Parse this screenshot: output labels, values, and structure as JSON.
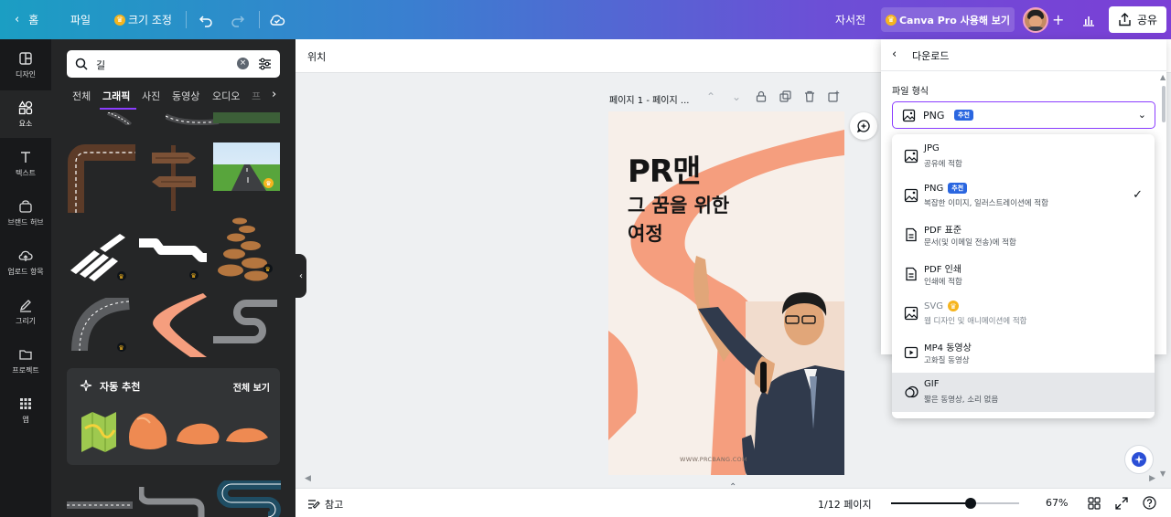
{
  "topbar": {
    "home": "홈",
    "file": "파일",
    "resize": "크기 조정",
    "doc_title": "자서전",
    "pro": "Canva Pro 사용해 보기",
    "share": "공유"
  },
  "rail": [
    {
      "label": "디자인",
      "icon": "layout-icon"
    },
    {
      "label": "요소",
      "icon": "elements-icon"
    },
    {
      "label": "텍스트",
      "icon": "text-icon"
    },
    {
      "label": "브랜드 허브",
      "icon": "brand-icon"
    },
    {
      "label": "업로드 항목",
      "icon": "upload-icon"
    },
    {
      "label": "그리기",
      "icon": "draw-icon"
    },
    {
      "label": "프로젝트",
      "icon": "folder-icon"
    },
    {
      "label": "앱",
      "icon": "apps-icon"
    }
  ],
  "panel": {
    "search_value": "길",
    "tabs": [
      "전체",
      "그래픽",
      "사진",
      "동영상",
      "오디오",
      "프"
    ],
    "ai_title": "자동 추천",
    "ai_all": "전체 보기"
  },
  "editor": {
    "position": "위치",
    "page_label": "페이지 1 - 페이지 ...",
    "notes": "참고",
    "page_count": "1/12 페이지",
    "zoom": "67%",
    "zoom_level": 0.62
  },
  "design": {
    "title": "PR맨",
    "subtitle_1": "그 꿈을 위한",
    "subtitle_2": "여정",
    "url": "WWW.PRCBANG.COM"
  },
  "download": {
    "title": "다운로드",
    "file_type_label": "파일 형식",
    "selected": "PNG",
    "recommended": "추천",
    "options": [
      {
        "name": "JPG",
        "desc": "공유에 적합",
        "icon": "image-icon"
      },
      {
        "name": "PNG",
        "desc": "복잡한 이미지, 일러스트레이션에 적합",
        "icon": "image-icon",
        "badge": "추천",
        "selected": true
      },
      {
        "name": "PDF 표준",
        "desc": "문서(및 이메일 전송)에 적합",
        "icon": "document-icon"
      },
      {
        "name": "PDF 인쇄",
        "desc": "인쇄에 적합",
        "icon": "document-icon"
      },
      {
        "name": "SVG",
        "desc": "웹 디자인 및 애니메이션에 적합",
        "icon": "image-icon",
        "pro": true
      },
      {
        "name": "MP4 동영상",
        "desc": "고화질 동영상",
        "icon": "video-icon"
      },
      {
        "name": "GIF",
        "desc": "짧은 동영상, 소리 없음",
        "icon": "gif-icon",
        "hover": true
      }
    ]
  },
  "colors": {
    "accent": "#8b3dff",
    "badge": "#2a66e0",
    "crown": "#f6b51e",
    "road_peach": "#f59e7e"
  }
}
